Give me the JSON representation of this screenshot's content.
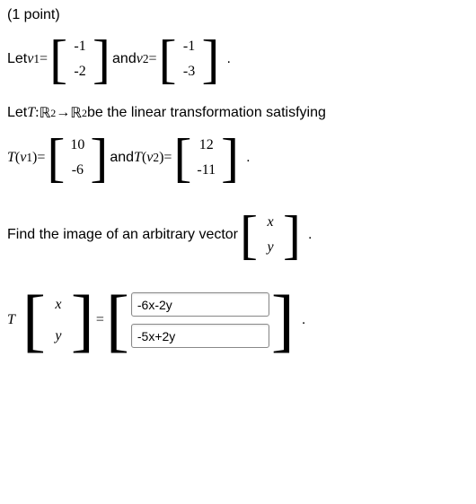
{
  "points": "(1 point)",
  "line1": {
    "let": "Let ",
    "v1": "v",
    "sub1": "1",
    "eq": " = ",
    "m1_top": "-1",
    "m1_bot": "-2",
    "and": " and ",
    "v2": "v",
    "sub2": "2",
    "m2_top": "-1",
    "m2_bot": "-3",
    "period": "."
  },
  "line2": {
    "let": "Let ",
    "T": "T",
    "colon": " : ",
    "R": "ℝ",
    "sup2a": "2",
    "arrow": " → ",
    "sup2b": "2",
    "be": " be the linear transformation satisfying"
  },
  "line3": {
    "T": "T",
    "lp": "(",
    "v1": "v",
    "sub1": "1",
    "rp": ")",
    "eq": " = ",
    "m1_top": "10",
    "m1_bot": "-6",
    "and": " and ",
    "v2": "v",
    "sub2": "2",
    "m2_top": "12",
    "m2_bot": "-11",
    "period": "."
  },
  "line4": {
    "text": "Find the image of an arbitrary vector ",
    "vtop": "x",
    "vbot": "y",
    "period": "."
  },
  "line5": {
    "T": "T",
    "vtop": "x",
    "vbot": "y",
    "eq": " = ",
    "ans_top": "-6x-2y",
    "ans_bot": "-5x+2y",
    "period": "."
  }
}
